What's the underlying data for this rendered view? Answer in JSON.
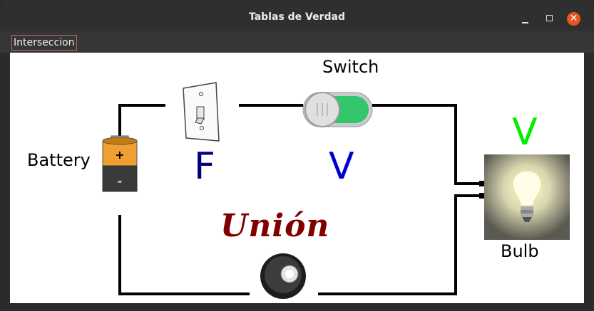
{
  "window": {
    "title": "Tablas de Verdad",
    "controls": {
      "minimize_icon": "minimize-icon",
      "maximize_icon": "maximize-icon",
      "close_glyph": "✕"
    }
  },
  "menu": {
    "items": [
      {
        "label": "Interseccion"
      }
    ]
  },
  "circuit": {
    "switch_label": "Switch",
    "battery_label": "Battery",
    "bulb_label": "Bulb",
    "gate_label": "Unión",
    "wall_switch_state": "F",
    "toggle_switch_state": "V",
    "bulb_state": "V",
    "colors": {
      "false_value": "#000080",
      "true_value": "#0000cc",
      "bulb_on": "#00ee00",
      "gate_label": "#800000",
      "toggle_on": "#34c66a"
    }
  }
}
